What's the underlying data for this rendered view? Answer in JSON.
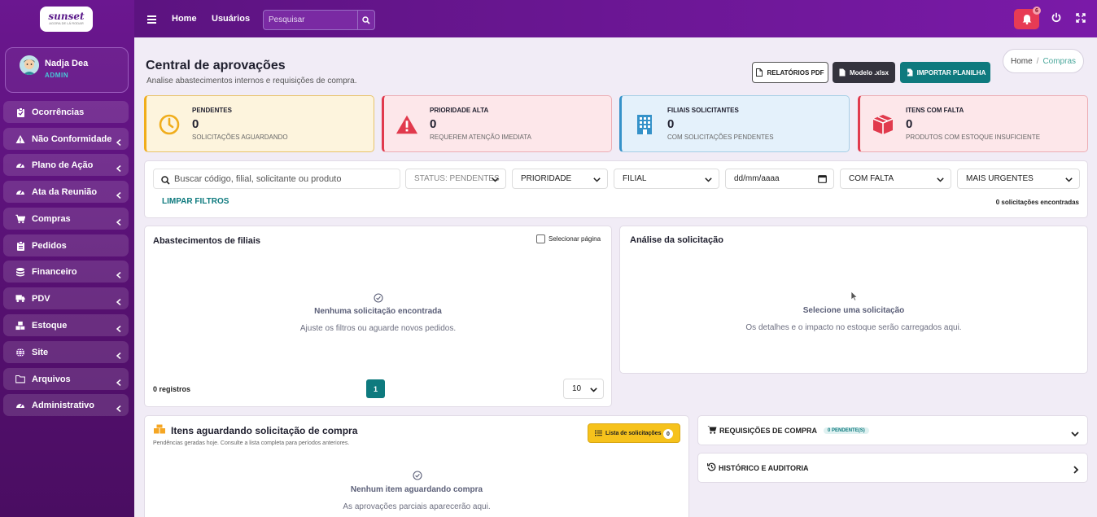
{
  "brand": {
    "logo_text": "sunset",
    "logo_sub": "AGORA DE LÁ RODAR"
  },
  "user": {
    "name": "Nadja Dea",
    "role": "ADMIN"
  },
  "sidebar": {
    "items": [
      {
        "label": "Ocorrências",
        "icon": "clipboard-icon",
        "has_submenu": false
      },
      {
        "label": "Não Conformidade",
        "icon": "warning-icon",
        "has_submenu": true
      },
      {
        "label": "Plano de Ação",
        "icon": "gauge-icon",
        "has_submenu": true
      },
      {
        "label": "Ata da Reunião",
        "icon": "gauge-icon",
        "has_submenu": true
      },
      {
        "label": "Compras",
        "icon": "cart-icon",
        "has_submenu": true
      },
      {
        "label": "Pedidos",
        "icon": "clipboard-icon",
        "has_submenu": false
      },
      {
        "label": "Financeiro",
        "icon": "coins-icon",
        "has_submenu": true
      },
      {
        "label": "PDV",
        "icon": "truck-icon",
        "has_submenu": true
      },
      {
        "label": "Estoque",
        "icon": "boxes-icon",
        "has_submenu": true
      },
      {
        "label": "Site",
        "icon": "globe-icon",
        "has_submenu": true
      },
      {
        "label": "Arquivos",
        "icon": "folder-icon",
        "has_submenu": true
      },
      {
        "label": "Administrativo",
        "icon": "gauge-icon",
        "has_submenu": true
      }
    ]
  },
  "topbar": {
    "links": [
      "Home",
      "Usuários"
    ],
    "search_placeholder": "Pesquisar",
    "notification_count": "6"
  },
  "header": {
    "title": "Central de aprovações",
    "subtitle": "Analise abastecimentos internos e requisições de compra.",
    "buttons": {
      "pdf": "RELATÓRIOS PDF",
      "xlsx": "Modelo .xlsx",
      "import": "IMPORTAR PLANILHA"
    },
    "breadcrumb": {
      "home": "Home",
      "separator": "/",
      "current": "Compras"
    }
  },
  "stats": [
    {
      "title": "PENDENTES",
      "value": "0",
      "desc": "SOLICITAÇÕES AGUARDANDO",
      "icon": "clock-icon",
      "color": "#f0ad1c"
    },
    {
      "title": "PRIORIDADE ALTA",
      "value": "0",
      "desc": "REQUEREM ATENÇÃO IMEDIATA",
      "icon": "alert-triangle-icon",
      "color": "#e13a4d"
    },
    {
      "title": "FILIAIS SOLICITANTES",
      "value": "0",
      "desc": "COM SOLICITAÇÕES PENDENTES",
      "icon": "building-icon",
      "color": "#3592c9"
    },
    {
      "title": "ITENS COM FALTA",
      "value": "0",
      "desc": "PRODUTOS COM ESTOQUE INSUFICIENTE",
      "icon": "box-icon",
      "color": "#e13a4d"
    }
  ],
  "filters": {
    "search_placeholder": "Buscar código, filial, solicitante ou produto",
    "status": "STATUS: PENDENTES",
    "priority": "PRIORIDADE",
    "branch": "FILIAL",
    "date": "dd/mm/aaaa",
    "shortage": "COM FALTA",
    "sort": "MAIS URGENTES",
    "clear": "LIMPAR FILTROS",
    "count": "0 solicitações encontradas"
  },
  "supply": {
    "title": "Abastecimentos de filiais",
    "select_page": "Selecionar página",
    "empty_title": "Nenhuma solicitação encontrada",
    "empty_sub": "Ajuste os filtros ou aguarde novos pedidos.",
    "records": "0 registros",
    "page": "1",
    "per_page": "10"
  },
  "analysis": {
    "title": "Análise da solicitação",
    "empty_title": "Selecione uma solicitação",
    "empty_sub": "Os detalhes e o impacto no estoque serão carregados aqui."
  },
  "waiting": {
    "title": "Itens aguardando solicitação de compra",
    "subtitle": "Pendências geradas hoje. Consulte a lista completa para períodos anteriores.",
    "list_button": "Lista de solicitações",
    "list_count": "0",
    "empty_title": "Nenhum item aguardando compra",
    "empty_sub": "As aprovações parciais aparecerão aqui."
  },
  "accordions": {
    "requisitions": {
      "title": "REQUISIÇÕES DE COMPRA",
      "badge": "0 PENDENTE(S)"
    },
    "history": {
      "title": "HISTÓRICO E AUDITORIA"
    }
  },
  "colors": {
    "primary": "#6b1790",
    "teal": "#0e7a7e",
    "danger": "#e73b55",
    "warning": "#f6c21c"
  }
}
